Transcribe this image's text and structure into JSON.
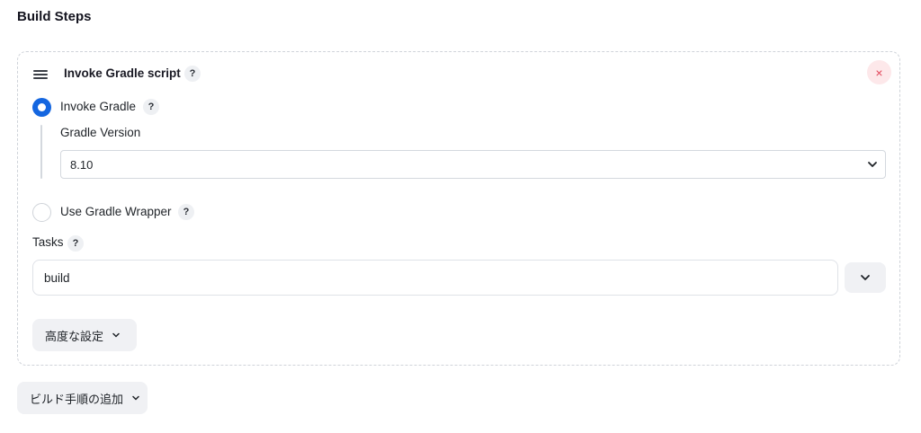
{
  "section": {
    "title": "Build Steps"
  },
  "step": {
    "title": "Invoke Gradle script",
    "help": "?",
    "close_symbol": "×"
  },
  "invoke_gradle": {
    "label": "Invoke Gradle",
    "help": "?",
    "selected": true,
    "version_label": "Gradle Version",
    "version_value": "8.10"
  },
  "wrapper": {
    "label": "Use Gradle Wrapper",
    "help": "?",
    "selected": false
  },
  "tasks": {
    "label": "Tasks",
    "help": "?",
    "value": "build"
  },
  "advanced": {
    "label": "高度な設定"
  },
  "add_step": {
    "label": "ビルド手順の追加"
  },
  "colors": {
    "accent": "#1466e0",
    "danger": "#e2465a",
    "danger_bg": "#fde8ea",
    "button_bg": "#f0f1f4"
  }
}
